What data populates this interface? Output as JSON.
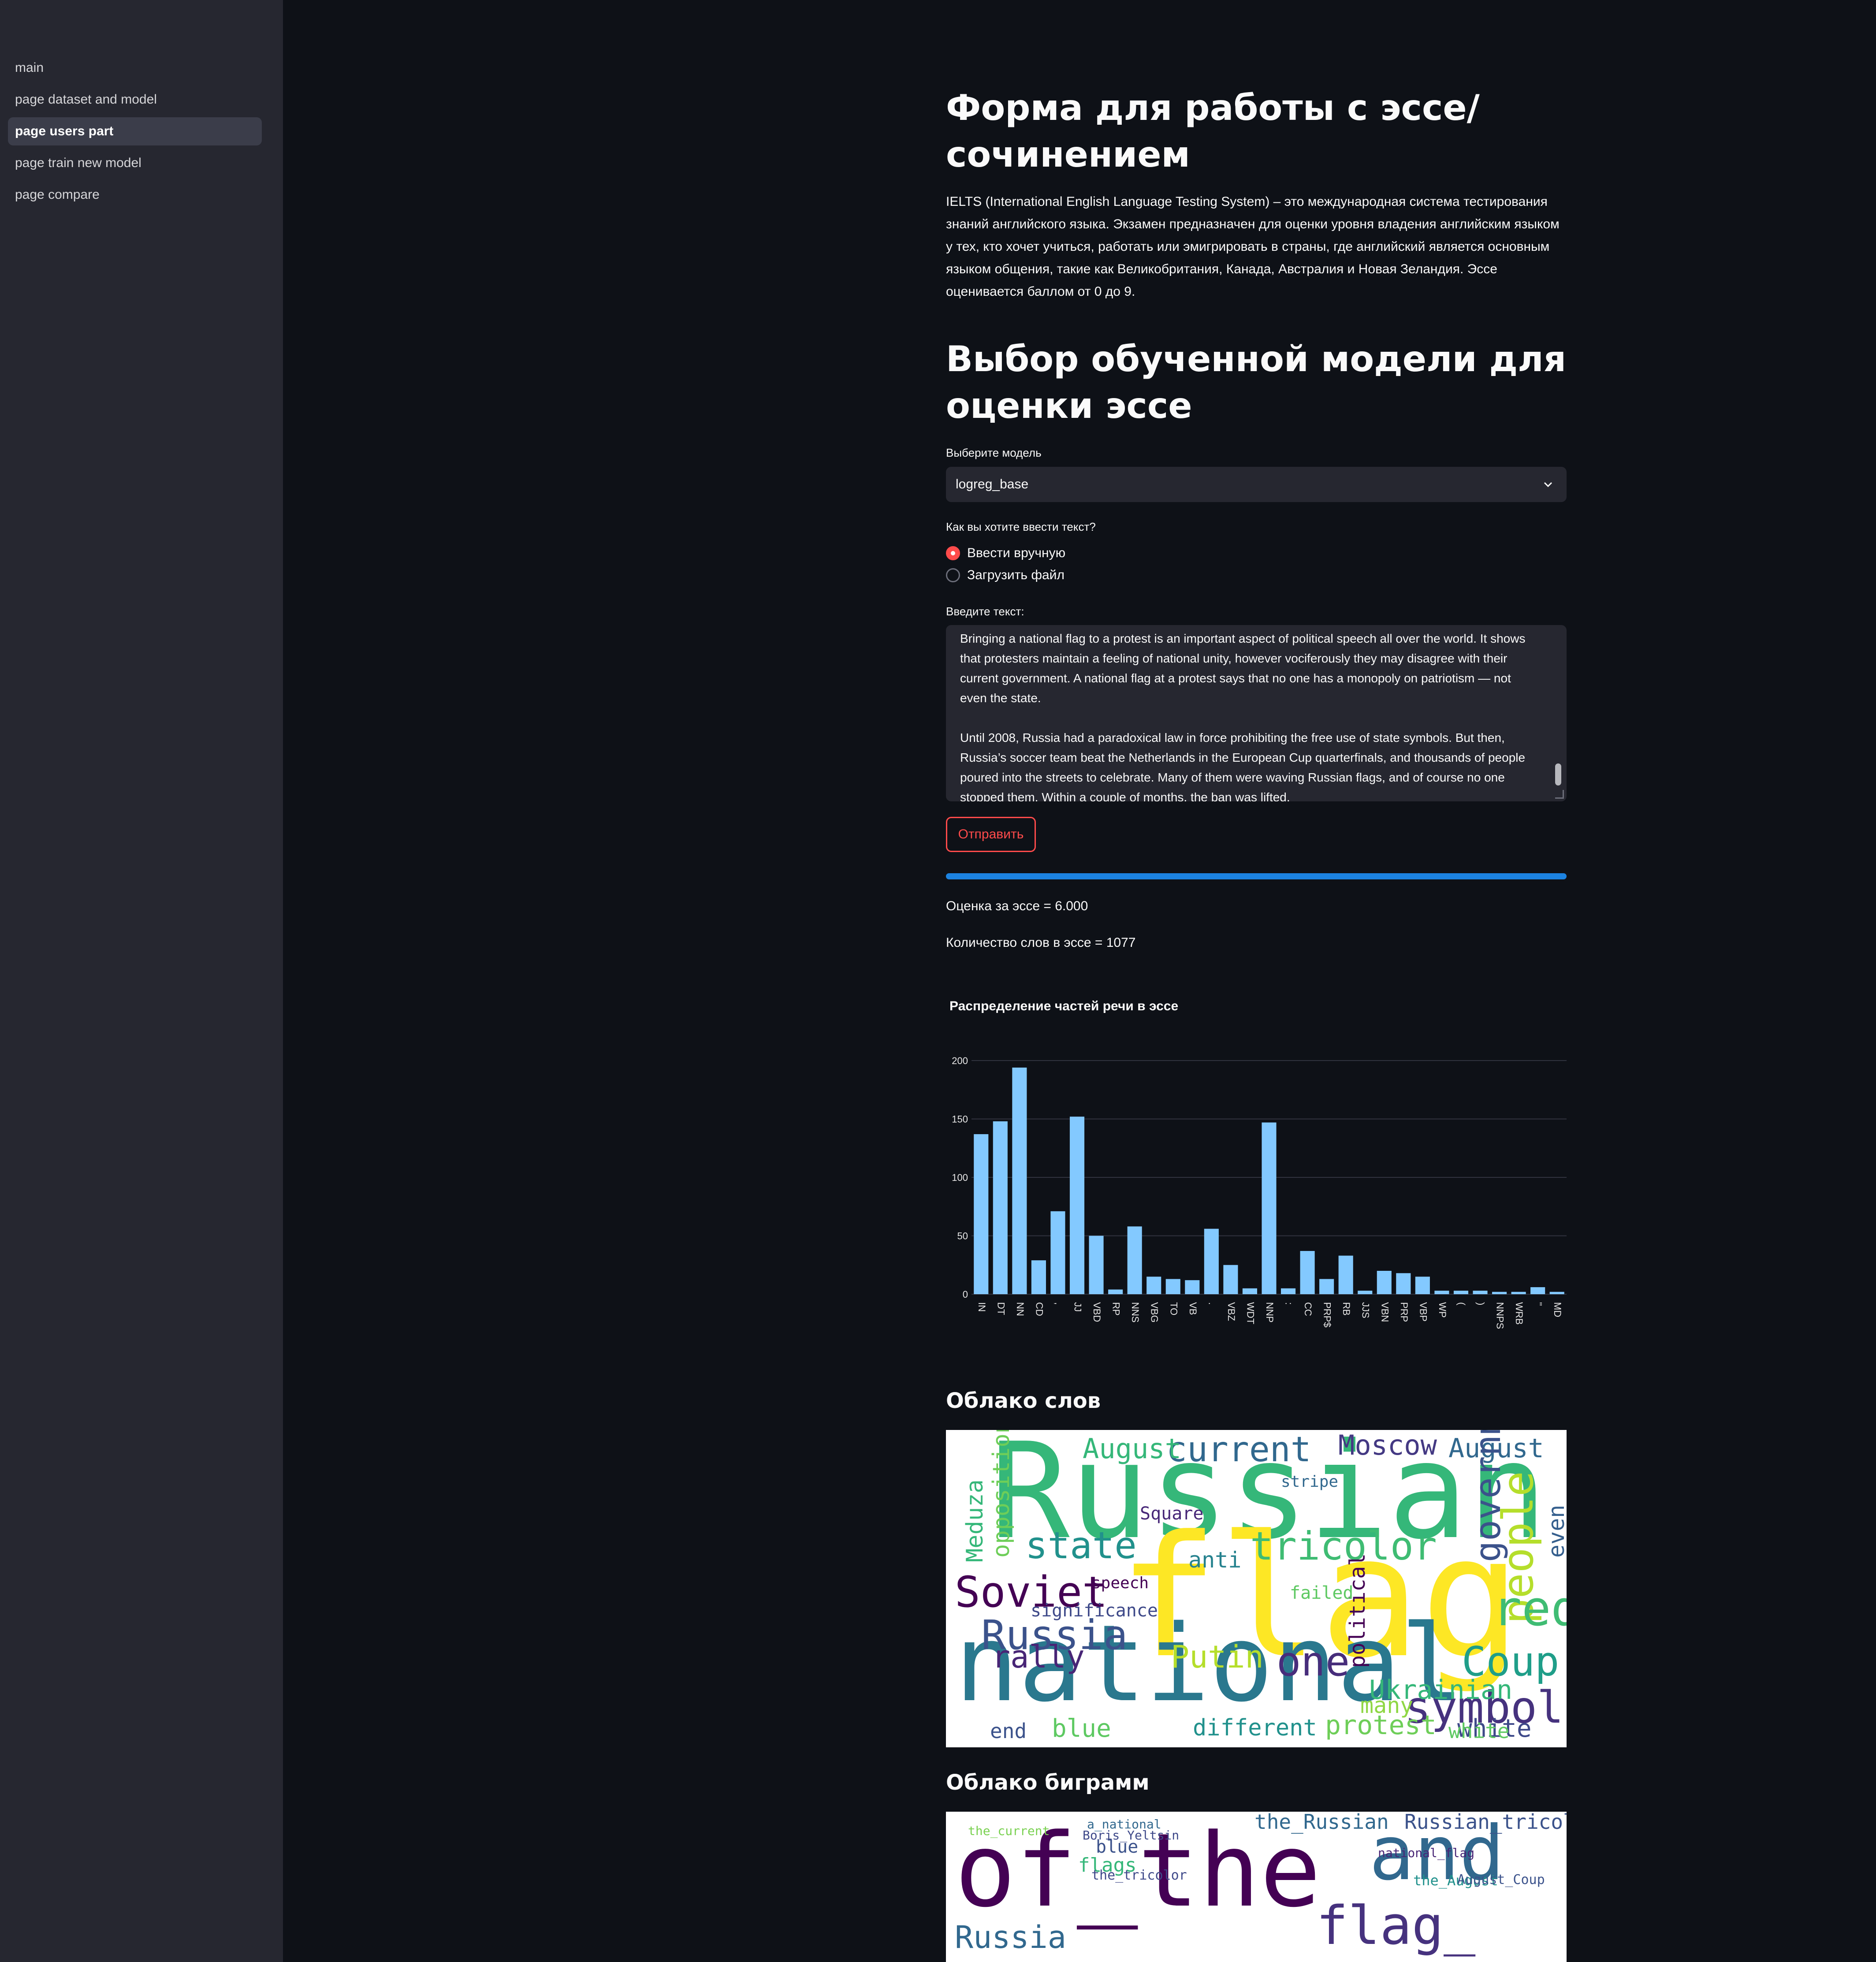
{
  "sidebar": {
    "items": [
      {
        "label": "main",
        "active": false
      },
      {
        "label": "page dataset and model",
        "active": false
      },
      {
        "label": "page users part",
        "active": true
      },
      {
        "label": "page train new model",
        "active": false
      },
      {
        "label": "page compare",
        "active": false
      }
    ]
  },
  "page": {
    "title": "Форма для работы с эссе/ сочинением",
    "intro": "IELTS (International English Language Testing System) – это международная система тестирования знаний английского языка. Экзамен предназначен для оценки уровня владения английским языком у тех, кто хочет учиться, работать или эмигрировать в страны, где английский является основным языком общения, такие как Великобритания, Канада, Австралия и Новая Зеландия. Эссе оценивается баллом от 0 до 9.",
    "model_section_title": "Выбор обученной модели для оценки эссе",
    "model_select_label": "Выберите модель",
    "model_select_value": "logreg_base",
    "input_mode_label": "Как вы хотите ввести текст?",
    "input_mode_options": [
      "Ввести вручную",
      "Загрузить файл"
    ],
    "input_mode_selected": 0,
    "text_label": "Введите текст:",
    "text_paragraph_1": "Bringing a national flag to a protest is an important aspect of political speech all over the world. It shows that protesters maintain a feeling of national unity, however vociferously they may disagree with their current government. A national flag at a protest says that no one has a monopoly on patriotism — not even the state.",
    "text_paragraph_2": "Until 2008, Russia had a paradoxical law in force prohibiting the free use of state symbols. But then, Russia’s soccer team beat the Netherlands in the European Cup quarterfinals, and thousands of people poured into the streets to celebrate. Many of them were waving Russian flags, and of course no one stopped them. Within a couple of months, the ban was lifted.",
    "submit_label": "Отправить",
    "progress": 1.0,
    "score_text": "Оценка за эссе = 6.000",
    "words_text": "Количество слов в эссе = 1077",
    "wordcloud_title": "Облако слов",
    "bigram_title": "Облако биграмм"
  },
  "colors": {
    "accent": "#ff4b4b",
    "progress": "#1c83e1",
    "bar": "#83c9ff",
    "background": "#0e1117",
    "sidebar": "#262730"
  },
  "icons": {
    "select_chevron": "chevron-down-icon"
  },
  "chart_data": {
    "type": "bar",
    "title": "Распределение частей речи в эссе",
    "xlabel": "",
    "ylabel": "",
    "ylim": [
      0,
      200
    ],
    "yticks": [
      0,
      50,
      100,
      150,
      200
    ],
    "grid": true,
    "categories": [
      "IN",
      "DT",
      "NN",
      "CD",
      ",",
      "JJ",
      "VBD",
      "RP",
      "NNS",
      "VBG",
      "TO",
      "VB",
      ".",
      "VBZ",
      "WDT",
      "NNP",
      ":",
      "CC",
      "PRP$",
      "RB",
      "JJS",
      "VBN",
      "PRP",
      "VBP",
      "WP",
      "(",
      ")",
      "NNPS",
      "WRB",
      "''",
      "MD"
    ],
    "values": [
      137,
      148,
      194,
      29,
      71,
      152,
      50,
      4,
      58,
      15,
      13,
      12,
      56,
      25,
      5,
      147,
      5,
      37,
      13,
      33,
      3,
      20,
      18,
      15,
      3,
      3,
      3,
      2,
      2,
      6,
      2
    ]
  },
  "wordcloud": {
    "words": [
      {
        "text": "Russian",
        "color": "#35b779"
      },
      {
        "text": "flag",
        "color": "#fde725"
      },
      {
        "text": "national",
        "color": "#2a788e"
      },
      {
        "text": "current",
        "color": "#31688e"
      },
      {
        "text": "Moscow",
        "color": "#443983"
      },
      {
        "text": "August",
        "color": "#35b779"
      },
      {
        "text": "August",
        "color": "#31688e"
      },
      {
        "text": "state",
        "color": "#21918c"
      },
      {
        "text": "tricolor",
        "color": "#3fbc73"
      },
      {
        "text": "Soviet",
        "color": "#440154"
      },
      {
        "text": "Russia",
        "color": "#3b528b"
      },
      {
        "text": "people",
        "color": "#b5de2b"
      },
      {
        "text": "red",
        "color": "#3fbc73"
      },
      {
        "text": "Coup",
        "color": "#1f9e89"
      },
      {
        "text": "symbol",
        "color": "#46327e"
      },
      {
        "text": "one",
        "color": "#472d7b"
      },
      {
        "text": "Putin",
        "color": "#b5de2b"
      },
      {
        "text": "rally",
        "color": "#482576"
      },
      {
        "text": "Ukrainian",
        "color": "#35b779"
      },
      {
        "text": "protest",
        "color": "#6ece58"
      },
      {
        "text": "white",
        "color": "#3e4989"
      },
      {
        "text": "blue",
        "color": "#5ec962"
      },
      {
        "text": "different",
        "color": "#21918c"
      },
      {
        "text": "end",
        "color": "#3b528b"
      },
      {
        "text": "white",
        "color": "#5ec962"
      },
      {
        "text": "government",
        "color": "#3b528b"
      },
      {
        "text": "opposition",
        "color": "#6ece58"
      },
      {
        "text": "Meduza",
        "color": "#35b779"
      },
      {
        "text": "political",
        "color": "#440154"
      },
      {
        "text": "many",
        "color": "#8fd744"
      },
      {
        "text": "even",
        "color": "#355f8d"
      },
      {
        "text": "anti",
        "color": "#26828e"
      },
      {
        "text": "speech",
        "color": "#440154"
      },
      {
        "text": "significance",
        "color": "#3e4989"
      },
      {
        "text": "stripe",
        "color": "#31688e"
      },
      {
        "text": "Square",
        "color": "#482878"
      },
      {
        "text": "failed",
        "color": "#5ec962"
      }
    ]
  },
  "bigramcloud": {
    "words": [
      {
        "text": "of_the",
        "color": "#440154"
      },
      {
        "text": "and",
        "color": "#31688e"
      },
      {
        "text": "the_Russian",
        "color": "#31688e"
      },
      {
        "text": "Russian_tricolor",
        "color": "#3b528b"
      },
      {
        "text": "flag_",
        "color": "#46327e"
      },
      {
        "text": "Russia",
        "color": "#31688e"
      },
      {
        "text": "blue",
        "color": "#3b528b"
      },
      {
        "text": "flags",
        "color": "#35b779"
      },
      {
        "text": "the_August",
        "color": "#21918c"
      },
      {
        "text": "August_Coup",
        "color": "#3b528b"
      },
      {
        "text": "national_flag",
        "color": "#482576"
      },
      {
        "text": "Boris_Yeltsin",
        "color": "#3e4989"
      },
      {
        "text": "the_tricolor",
        "color": "#3e4989"
      },
      {
        "text": "the_current",
        "color": "#7ad151"
      },
      {
        "text": "a_national",
        "color": "#31688e"
      }
    ]
  }
}
